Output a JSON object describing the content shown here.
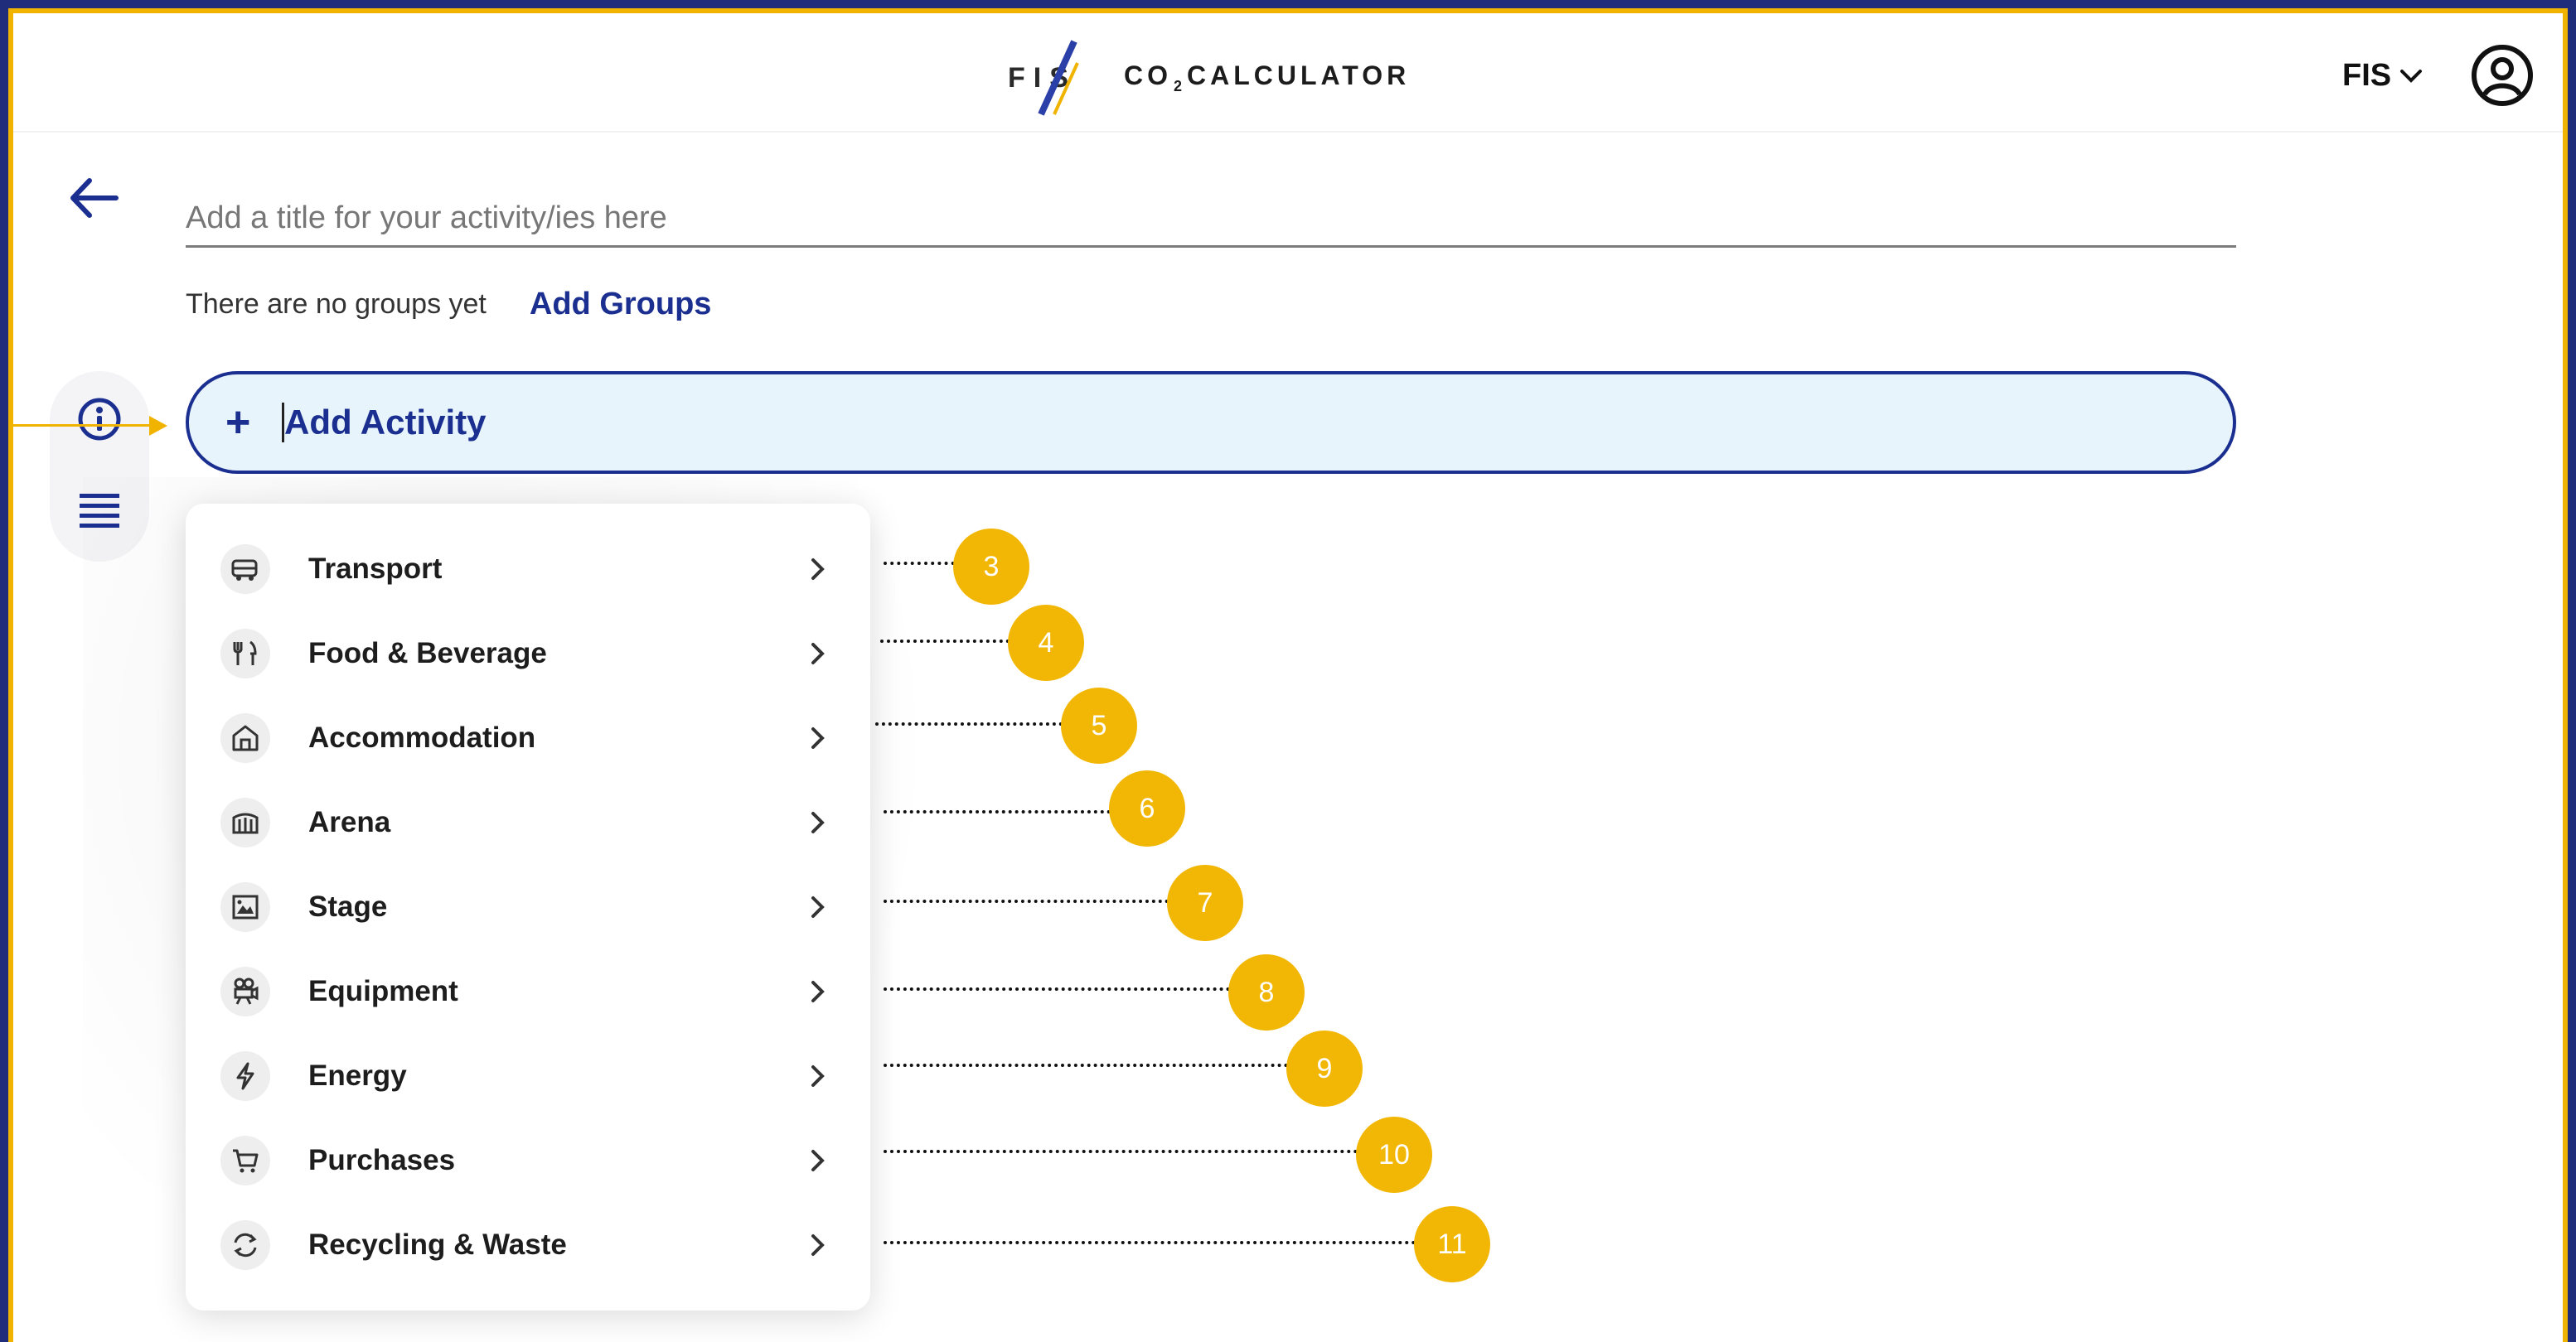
{
  "header": {
    "logo_text": "FIS",
    "app_title_prefix": "CO",
    "app_title_sub": "2",
    "app_title_suffix": "CALCULATOR",
    "org_label": "FIS"
  },
  "form": {
    "title_placeholder": "Add a title for your activity/ies here",
    "groups_empty_text": "There are no groups yet",
    "add_groups_label": "Add Groups",
    "add_activity_label": "Add Activity",
    "add_activity_icon": "+"
  },
  "menu": {
    "items": [
      {
        "label": "Transport",
        "icon": "bus-icon"
      },
      {
        "label": "Food & Beverage",
        "icon": "cutlery-icon"
      },
      {
        "label": "Accommodation",
        "icon": "house-icon"
      },
      {
        "label": "Arena",
        "icon": "arena-icon"
      },
      {
        "label": "Stage",
        "icon": "stage-icon"
      },
      {
        "label": "Equipment",
        "icon": "camera-icon"
      },
      {
        "label": "Energy",
        "icon": "lightning-icon"
      },
      {
        "label": "Purchases",
        "icon": "cart-icon"
      },
      {
        "label": "Recycling & Waste",
        "icon": "recycle-icon"
      }
    ]
  },
  "callouts": [
    "3",
    "4",
    "5",
    "6",
    "7",
    "8",
    "9",
    "10",
    "11"
  ],
  "colors": {
    "brand_blue": "#1b2f91",
    "accent_yellow": "#f2b705",
    "input_bg": "#e7f4fb"
  }
}
